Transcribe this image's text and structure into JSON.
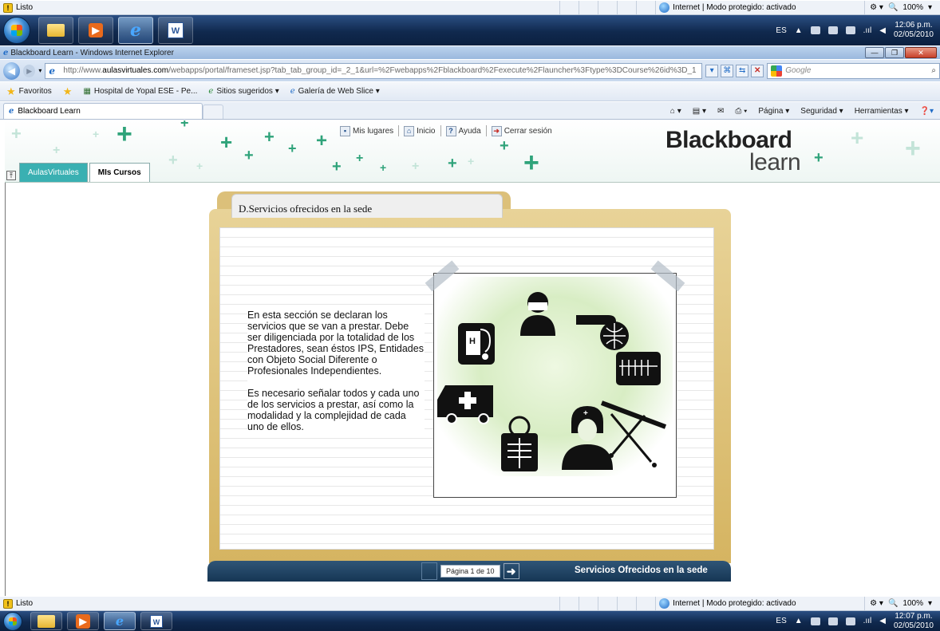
{
  "status_top": {
    "text": "Listo",
    "zone": "Internet | Modo protegido: activado",
    "zoom": "100%"
  },
  "taskbar_top": {
    "lang": "ES",
    "time": "12:06 p.m.",
    "date": "02/05/2010"
  },
  "window": {
    "title": "Blackboard Learn - Windows Internet Explorer"
  },
  "address": {
    "url_prefix": "http://www.",
    "url_domain": "aulasvirtuales.com",
    "url_rest": "/webapps/portal/frameset.jsp?tab_tab_group_id=_2_1&url=%2Fwebapps%2Fblackboard%2Fexecute%2Flauncher%3Ftype%3DCourse%26id%3D_1",
    "search_placeholder": "Google"
  },
  "favorites": {
    "label": "Favoritos",
    "items": [
      "Hospital de Yopal ESE - Pe...",
      "Sitios sugeridos ▾",
      "Galería de Web Slice ▾"
    ]
  },
  "tab": {
    "label": "Blackboard Learn"
  },
  "commandbar": {
    "items": [
      "Página ▾",
      "Seguridad ▾",
      "Herramientas ▾"
    ]
  },
  "bb": {
    "links": [
      "Mis lugares",
      "Inicio",
      "Ayuda",
      "Cerrar sesión"
    ],
    "logo_main": "Blackboard",
    "logo_sub": "learn",
    "tabs": [
      "AulasVirtuales",
      "MIs Cursos"
    ]
  },
  "content": {
    "folder_title": "D.Servicios ofrecidos en la sede",
    "paragraph1": "En esta sección se declaran los servicios que se van a prestar. Debe ser diligenciada por la totalidad de los Prestadores, sean éstos IPS, Entidades con Objeto Social Diferente o Profesionales Independientes.",
    "paragraph2": "Es necesario señalar todos y cada uno de los servicios a prestar, así como la modalidad y la complejidad de cada uno de ellos.",
    "pager": "Página 1 de 10",
    "section_title": "Servicios Ofrecidos en la sede"
  },
  "status_bottom": {
    "text": "Listo",
    "zone": "Internet | Modo protegido: activado",
    "zoom": "100%"
  },
  "taskbar_bottom": {
    "lang": "ES",
    "time": "12:07 p.m.",
    "date": "02/05/2010"
  }
}
